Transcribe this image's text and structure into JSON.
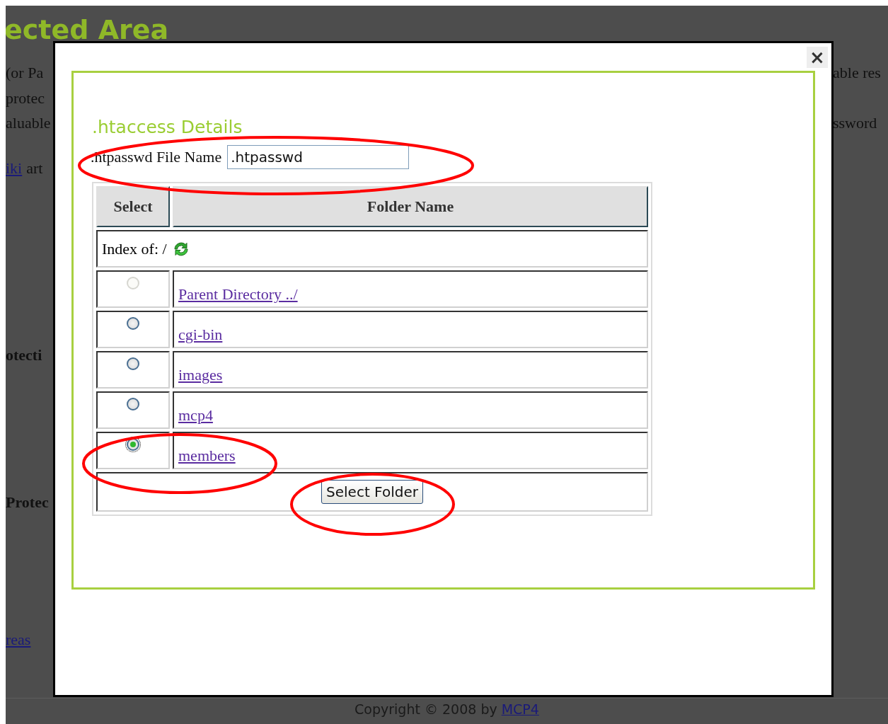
{
  "background": {
    "heading": "ected Area",
    "left_lines": [
      [
        {
          "kind": "text",
          "text": "(or Pa"
        }
      ],
      [
        {
          "kind": "text",
          "text": "protec"
        }
      ],
      [
        {
          "kind": "text",
          "text": "aluable"
        }
      ],
      [
        {
          "kind": "link",
          "text": "iki"
        },
        {
          "kind": "text",
          "text": "art"
        }
      ],
      [
        {
          "kind": "heading",
          "text": "otecti"
        }
      ],
      [
        {
          "kind": "heading",
          "text": "Protec"
        }
      ],
      [
        {
          "kind": "link",
          "text": "reas"
        }
      ]
    ],
    "right_lines": [
      {
        "kind": "text",
        "text": "able res"
      },
      {
        "kind": "text",
        "text": "ssword"
      }
    ],
    "footer": {
      "text": "Copyright © 2008 by",
      "link": "MCP4"
    }
  },
  "modal": {
    "close": "×",
    "title": ".htaccess Details",
    "file_field": {
      "label": ".htpasswd File Name",
      "value": ".htpasswd"
    },
    "table": {
      "columns": [
        "Select",
        "Folder Name"
      ],
      "index_label": "Index of: /",
      "rows": [
        {
          "name": "Parent Directory ../",
          "selected": false,
          "disabled": true
        },
        {
          "name": "cgi-bin",
          "selected": false,
          "disabled": false
        },
        {
          "name": "images",
          "selected": false,
          "disabled": false
        },
        {
          "name": "mcp4",
          "selected": false,
          "disabled": false
        },
        {
          "name": "members",
          "selected": true,
          "disabled": false
        }
      ],
      "button": "Select Folder"
    }
  }
}
